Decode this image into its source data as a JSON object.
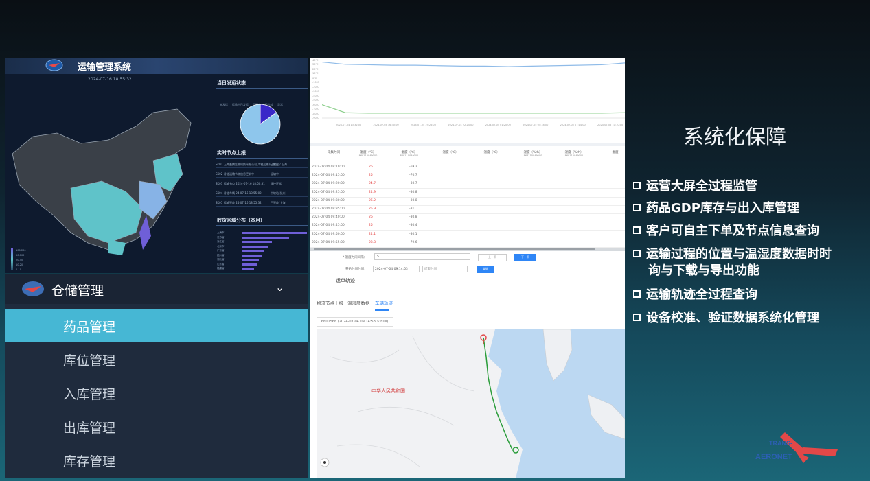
{
  "dashboard": {
    "title": "运输管理系统",
    "timestamp": "2024-07-16 18:55:32",
    "status_section": {
      "title": "当日发运状态",
      "legend": [
        "未发运",
        "运输中已发运",
        "已签收",
        "已完成",
        "异常"
      ],
      "pie_values": [
        15,
        85
      ]
    },
    "realtime_section": {
      "title": "实时节点上报",
      "rows": [
        {
          "id": "SK01",
          "text": "上海鑫鹏生物科技有限公司(冷链运输)已发出",
          "tag": "已发出 / 上海"
        },
        {
          "id": "SK02",
          "text": "冷链运输节点信息更新中",
          "tag": "运输中"
        },
        {
          "id": "SK03",
          "text": "运输节点 2024-07-16 18:50:31",
          "tag": "温控正常"
        },
        {
          "id": "SK04",
          "text": "冷链车辆 24-07-16 18:55:02",
          "tag": "中转站(杭州)"
        },
        {
          "id": "SK05",
          "text": "运输签收 24-07-16 18:55:32",
          "tag": "已签收(上海)"
        }
      ]
    },
    "region_section": {
      "title": "收货区域分布（本月）",
      "labels": [
        "上海市",
        "江苏省",
        "浙江省",
        "北京市",
        "广东省",
        "四川省",
        "湖北省",
        "山东省",
        "福建省"
      ],
      "values": [
        100,
        72,
        46,
        40,
        34,
        30,
        26,
        22,
        18
      ]
    },
    "map_legend": [
      "100-200",
      "50-100",
      "20-50",
      "10-20",
      "0-10"
    ]
  },
  "temp_chart": {
    "y_ticks": [
      "40℃",
      "30℃",
      "20℃",
      "10℃",
      "0℃",
      "-10℃",
      "-20℃",
      "-30℃",
      "-40℃",
      "-50℃",
      "-60℃",
      "-70℃",
      "-80℃",
      "-90℃"
    ],
    "x_ticks": [
      "2024-07-04 13:32:00",
      "2024-07-04 16:30:00",
      "2024-07-04 19:26:00",
      "2024-07-04 22:24:00",
      "2024-07-05 01:20:00",
      "2024-07-05 04:18:00",
      "2024-07-05 07:14:00",
      "2024-07-05 10:10:00"
    ],
    "series": [
      {
        "color": "#8fbbe8",
        "values": [
          36,
          31,
          30,
          29,
          29,
          28,
          27,
          27,
          26,
          27,
          28,
          29,
          30,
          34
        ]
      },
      {
        "color": "#8fd08f",
        "values": [
          -60,
          -78,
          -79,
          -79,
          -79,
          -79,
          -79,
          -79,
          -79,
          -79,
          -79,
          -79,
          -79,
          -78
        ]
      }
    ],
    "y_range": [
      -90,
      40
    ]
  },
  "table": {
    "headers": [
      {
        "label": "采集时间",
        "sub": ""
      },
      {
        "label": "温度（℃）",
        "sub": "868110049000"
      },
      {
        "label": "温度（℃）",
        "sub": "868110049001"
      },
      {
        "label": "温度（℃）",
        "sub": ""
      },
      {
        "label": "温度（℃）",
        "sub": ""
      },
      {
        "label": "湿度（%rh）",
        "sub": "868110049000"
      },
      {
        "label": "湿度（%rh）",
        "sub": "868110049001"
      },
      {
        "label": "湿度",
        "sub": ""
      }
    ],
    "rows": [
      {
        "time": "2024-07-04 09:10:00",
        "t1": "26",
        "t2": "-69.2"
      },
      {
        "time": "2024-07-04 09:15:00",
        "t1": "25",
        "t2": "-70.7"
      },
      {
        "time": "2024-07-04 09:20:00",
        "t1": "24.7",
        "t2": "-80.7"
      },
      {
        "time": "2024-07-04 09:25:00",
        "t1": "24.9",
        "t2": "-80.8"
      },
      {
        "time": "2024-07-04 09:30:00",
        "t1": "26.2",
        "t2": "-80.8"
      },
      {
        "time": "2024-07-04 09:35:00",
        "t1": "25.9",
        "t2": "-81"
      },
      {
        "time": "2024-07-04 09:40:00",
        "t1": "26",
        "t2": "-80.8"
      },
      {
        "time": "2024-07-04 09:45:00",
        "t1": "25",
        "t2": "-80.4"
      },
      {
        "time": "2024-07-04 09:50:00",
        "t1": "24.1",
        "t2": "-80.1"
      },
      {
        "time": "2024-07-04 09:55:00",
        "t1": "23.8",
        "t2": "-79.6"
      }
    ],
    "interval_label": "* 温度时间间隔：",
    "interval_value": "5",
    "prev_label": "上一页",
    "next_label": "下一页",
    "start_label": "开始时间时间：",
    "start_value": "2024-07-04 09:14:53",
    "end_placeholder": "结束时间",
    "query_label": "查询"
  },
  "menu": {
    "header": "仓储管理",
    "items": [
      {
        "label": "药品管理",
        "active": true
      },
      {
        "label": "库位管理",
        "active": false
      },
      {
        "label": "入库管理",
        "active": false
      },
      {
        "label": "出库管理",
        "active": false
      },
      {
        "label": "库存管理",
        "active": false
      }
    ]
  },
  "map_panel": {
    "title": "运单轨迹",
    "tabs": [
      {
        "label": "物流节点上报",
        "active": false
      },
      {
        "label": "温湿度数据",
        "active": false
      },
      {
        "label": "车辆轨迹",
        "active": true
      }
    ],
    "select_value": "6601566  (2024-07-04 09:14:53 ~ null)",
    "country_label": "中华人民共和国"
  },
  "slide": {
    "heading": "系统化保障",
    "bullets": [
      "运营大屏全过程监管",
      "药品GDP库存与出入库管理",
      "客户可自主下单及节点信息查询",
      "运输过程的位置与温湿度数据时时",
      "询与下载与导出功能",
      "运输轨迹全过程查询",
      "设备校准、验证数据系统化管理"
    ]
  },
  "brand": {
    "line1": "TRANS-",
    "line2": "AERONET"
  }
}
